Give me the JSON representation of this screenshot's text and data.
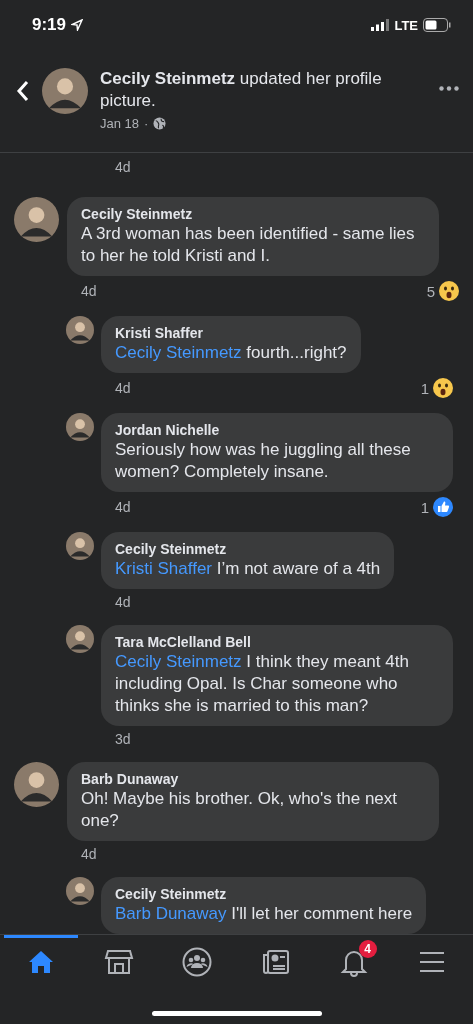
{
  "status_bar": {
    "time": "9:19",
    "network": "LTE"
  },
  "header": {
    "title": "**Cecily Steinmetz** updated her profile picture.",
    "date": "Jan 18",
    "separator": "·"
  },
  "previous_comment": {
    "time": "4d"
  },
  "comments": [
    {
      "author": "Cecily Steinmetz",
      "text": "A 3rd woman has been identified - same lies to her he told Kristi and I.",
      "time": "4d",
      "reaction": {
        "kind": "wow",
        "count": "5"
      },
      "replies": [
        {
          "author": "Kristi Shaffer",
          "mention": "Cecily Steinmetz",
          "text": "fourth...right?",
          "time": "4d",
          "reaction": {
            "kind": "wow",
            "count": "1"
          }
        },
        {
          "author": "Jordan Nichelle",
          "text": "Seriously how was he juggling all these women? Completely insane.",
          "time": "4d",
          "reaction": {
            "kind": "like",
            "count": "1"
          }
        },
        {
          "author": "Cecily Steinmetz",
          "mention": "Kristi Shaffer",
          "text": "I’m not aware of a 4th",
          "time": "4d"
        },
        {
          "author": "Tara McClelland Bell",
          "mention": "Cecily Steinmetz",
          "text": "I think they meant 4th including Opal. Is Char someone who thinks she is married to this man?",
          "time": "3d"
        }
      ]
    },
    {
      "author": "Barb Dunaway",
      "text": "Oh! Maybe his brother. Ok, who's the next one?",
      "time": "4d",
      "replies": [
        {
          "author": "Cecily Steinmetz",
          "mention": "Barb Dunaway",
          "text": "I'll let her comment here"
        }
      ]
    }
  ],
  "tab_bar": {
    "tabs": [
      {
        "kind": "home",
        "selected": true
      },
      {
        "kind": "marketplace",
        "selected": false
      },
      {
        "kind": "groups",
        "selected": false
      },
      {
        "kind": "news",
        "selected": false
      },
      {
        "kind": "notifications",
        "selected": false,
        "badge": "4"
      },
      {
        "kind": "menu",
        "selected": false
      }
    ]
  }
}
